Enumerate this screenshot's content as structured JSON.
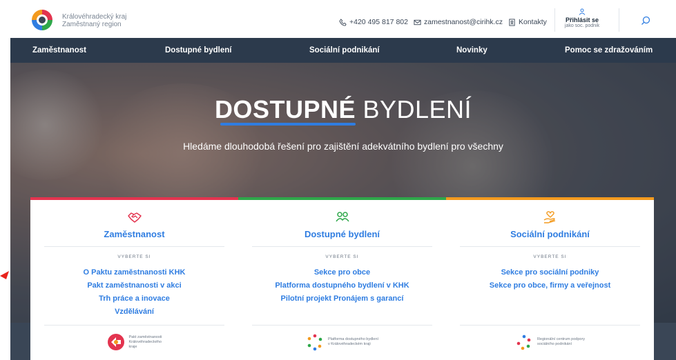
{
  "header": {
    "logo_line1": "Královéhradecký kraj",
    "logo_line2": "Zaměstnaný region",
    "phone": "+420 495 817 802",
    "email": "zamestnanost@cirihk.cz",
    "contacts": "Kontakty",
    "login_label": "Přihlásit se",
    "login_sub": "jako soc. podnik"
  },
  "nav": {
    "items": [
      "Zaměstnanost",
      "Dostupné bydlení",
      "Sociální podnikání",
      "Novinky",
      "Pomoc se zdražováním"
    ]
  },
  "hero": {
    "title_bold": "DOSTUPNÉ",
    "title_light": "BYDLENÍ",
    "subtitle": "Hledáme dlouhodobá řešení pro zajištění adekvátního bydlení pro všechny"
  },
  "cards": [
    {
      "title": "Zaměstnanost",
      "choose": "VYBERTE SI",
      "links": [
        "O Paktu zaměstnanosti KHK",
        "Pakt zaměstnanosti v akci",
        "Trh práce a inovace",
        "Vzdělávání"
      ],
      "partner": [
        "Pakt zaměstnanosti",
        "Královéhradeckého",
        "kraje"
      ],
      "accent": "#e3344f"
    },
    {
      "title": "Dostupné bydlení",
      "choose": "VYBERTE SI",
      "links": [
        "Sekce pro obce",
        "Platforma dostupného bydlení v KHK",
        "Pilotní projekt Pronájem s garancí"
      ],
      "partner": [
        "Platforma dostupného bydlení",
        "v Královéhradeckém kraji"
      ],
      "accent": "#2ea84a"
    },
    {
      "title": "Sociální podnikání",
      "choose": "VYBERTE SI",
      "links": [
        "Sekce pro sociální podniky",
        "Sekce pro obce, firmy a veřejnost"
      ],
      "partner": [
        "Regionální centrum podpory",
        "sociálního podnikání"
      ],
      "accent": "#f39a1e"
    }
  ],
  "colors": {
    "nav_bg": "#2c3a4c",
    "link_blue": "#2f7de1"
  }
}
